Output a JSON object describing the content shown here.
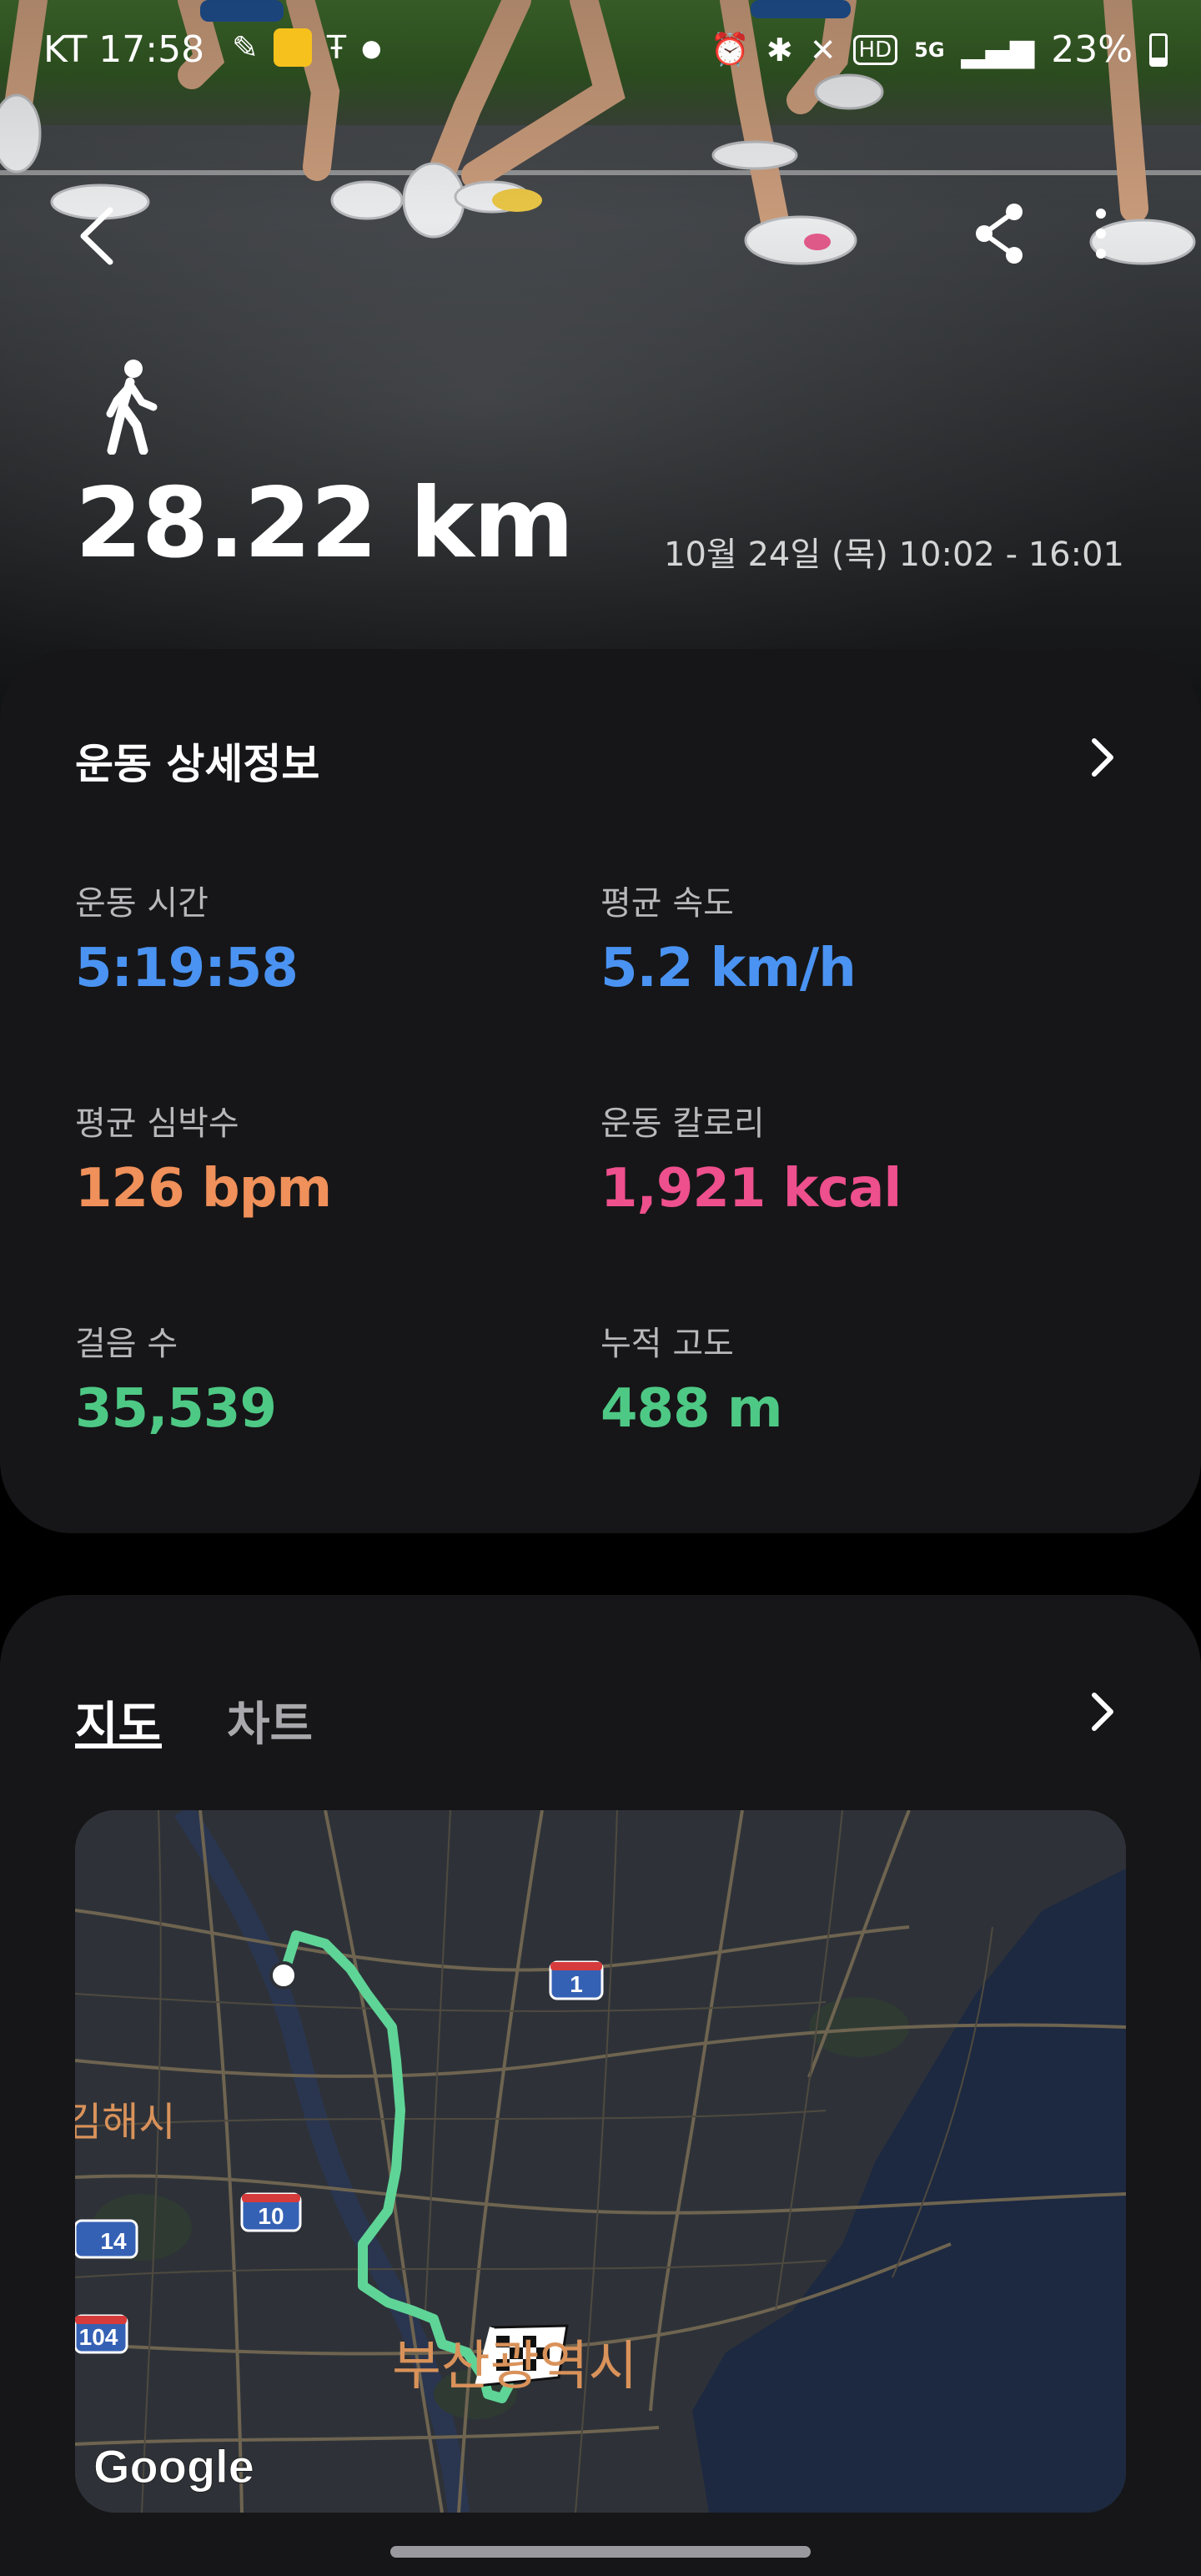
{
  "status_bar": {
    "carrier_time": "KT 17:58",
    "battery": "23%",
    "network": "5G"
  },
  "hero": {
    "activity_icon": "walking-person-icon",
    "distance": "28.22 km",
    "date_range": "10월 24일 (목) 10:02 - 16:01"
  },
  "details": {
    "title": "운동 상세정보",
    "metrics": [
      {
        "label": "운동 시간",
        "value": "5:19:58",
        "color": "#4a93f2"
      },
      {
        "label": "평균 속도",
        "value": "5.2 km/h",
        "color": "#4a93f2"
      },
      {
        "label": "평균 심박수",
        "value": "126 bpm",
        "color": "#f0905a"
      },
      {
        "label": "운동 칼로리",
        "value": "1,921 kcal",
        "color": "#ee4f8d"
      },
      {
        "label": "걸음 수",
        "value": "35,539",
        "color": "#4ec985"
      },
      {
        "label": "누적 고도",
        "value": "488 m",
        "color": "#4ec985"
      }
    ]
  },
  "map_section": {
    "tabs": [
      "지도",
      "차트"
    ],
    "active_tab": "지도",
    "map_labels": {
      "city": "부산광역시",
      "city_partial": "김해시",
      "route_1": "1",
      "route_10": "10",
      "route_14": "14",
      "route_104": "104",
      "attribution": "Google"
    },
    "route_color": "#5fd497"
  }
}
